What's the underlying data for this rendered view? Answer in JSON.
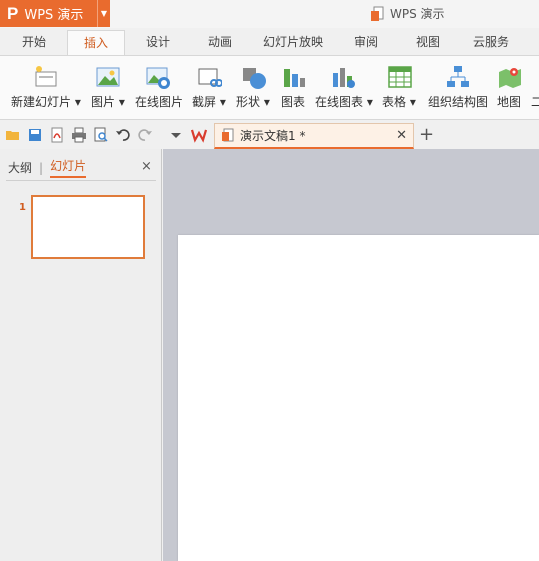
{
  "app": {
    "button_label": "WPS 演示",
    "logo": "P",
    "window_title": "WPS 演示"
  },
  "ribbon_tabs": [
    {
      "label": "开始"
    },
    {
      "label": "插入"
    },
    {
      "label": "设计"
    },
    {
      "label": "动画"
    },
    {
      "label": "幻灯片放映"
    },
    {
      "label": "审阅"
    },
    {
      "label": "视图"
    },
    {
      "label": "云服务"
    }
  ],
  "active_tab": "插入",
  "ribbon_buttons": [
    {
      "label": "新建幻灯片 ▾",
      "icon": "new-slide-icon"
    },
    {
      "label": "图片 ▾",
      "icon": "picture-icon"
    },
    {
      "label": "在线图片",
      "icon": "online-picture-icon"
    },
    {
      "label": "截屏 ▾",
      "icon": "screenshot-icon"
    },
    {
      "label": "形状 ▾",
      "icon": "shape-icon"
    },
    {
      "label": "图表",
      "icon": "chart-icon"
    },
    {
      "label": "在线图表 ▾",
      "icon": "online-chart-icon"
    },
    {
      "label": "表格 ▾",
      "icon": "table-icon"
    },
    {
      "label": "组织结构图",
      "icon": "org-chart-icon"
    },
    {
      "label": "地图",
      "icon": "map-icon"
    },
    {
      "label": "二",
      "icon": ""
    }
  ],
  "document_tab": {
    "title": "演示文稿1 *"
  },
  "panel": {
    "outline_tab": "大纲",
    "separator": "|",
    "slides_tab": "幻灯片",
    "close": "×"
  },
  "slides": [
    {
      "number": "1"
    }
  ],
  "colors": {
    "accent": "#e96b2e",
    "canvas_bg": "#c6c8d0"
  }
}
